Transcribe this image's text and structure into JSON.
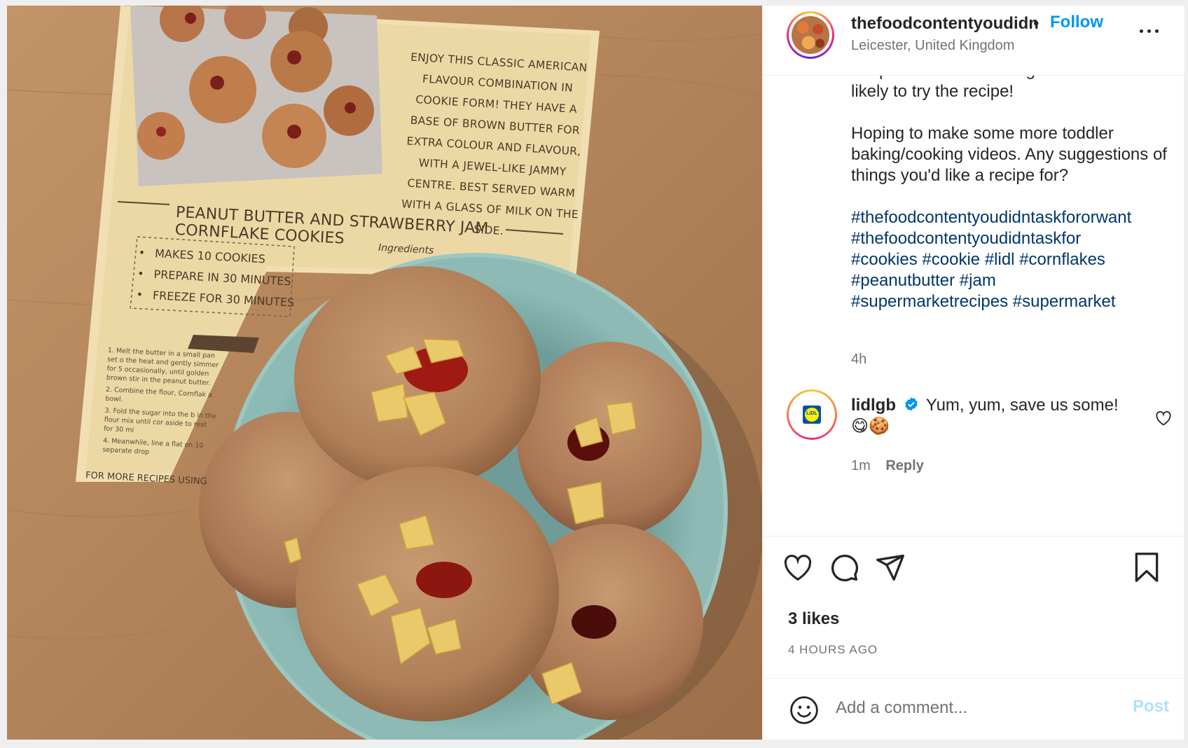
{
  "photo": {
    "blurb": "ENJOY THIS CLASSIC AMERICAN FLAVOUR COMBINATION IN COOKIE FORM! THEY HAVE A BASE OF BROWN BUTTER FOR EXTRA COLOUR AND FLAVOUR, WITH A JEWEL-LIKE JAMMY CENTRE. BEST SERVED WARM WITH A GLASS OF MILK ON THE SIDE.",
    "recipe_title": "PEANUT BUTTER AND STRAWBERRY JAM CORNFLAKE COOKIES",
    "ingredients_tag": "Ingredients",
    "facts": [
      "MAKES 10 COOKIES",
      "PREPARE IN 30 MINUTES",
      "FREEZE FOR 30 MINUTES"
    ],
    "method": [
      "1. Melt the butter in a small pan set o the heat and gently simmer for 5 occasionally, until golden brown stir in the peanut butter.",
      "2. Combine the flour, Cornflak a bowl.",
      "3. Fold the sugar into the b in the flour mix until cor aside to rest for 30 mi",
      "4. Meanwhile, line a flat on 10 separate drop"
    ],
    "more_recipes": "FOR MORE RECIPES USING"
  },
  "header": {
    "username": "thefoodcontentyoudidn",
    "separator": "•",
    "follow_label": "Follow",
    "location": "Leicester, United Kingdom"
  },
  "caption": {
    "partial_line": "If a photo of food looks good I'm more",
    "para1": "likely to try the recipe!",
    "para2": "Hoping to make some more toddler baking/cooking videos. Any suggestions of things you'd like a recipe for?",
    "hashtags": [
      "#thefoodcontentyoudidntaskfororwant",
      "#thefoodcontentyoudidntaskfor",
      "#cookies",
      "#cookie",
      "#lidl",
      "#cornflakes",
      "#peanutbutter",
      "#jam",
      "#supermarketrecipes",
      "#supermarket"
    ],
    "time": "4h"
  },
  "comment": {
    "username": "lidlgb",
    "logo_text": "LiDL",
    "text": "Yum, yum, save us some!",
    "emoji": "😋🍪",
    "time": "1m",
    "reply_label": "Reply"
  },
  "actions": {
    "likes": "3 likes",
    "time_ago": "4 HOURS AGO"
  },
  "add_comment": {
    "placeholder": "Add a comment...",
    "post_label": "Post"
  },
  "colors": {
    "accent": "#0095f6",
    "hashtag": "#00376b",
    "muted": "#737373",
    "post_disabled": "#b2dffc"
  },
  "icons": [
    "heart-icon",
    "comment-icon",
    "share-icon",
    "bookmark-icon",
    "more-icon",
    "emoji-icon",
    "verified-icon"
  ]
}
